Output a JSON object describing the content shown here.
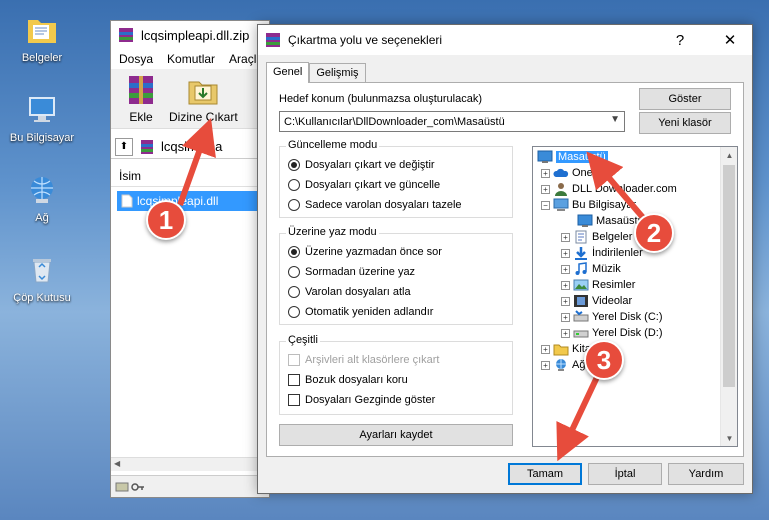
{
  "desktop": {
    "icons": [
      {
        "label": "Belgeler",
        "icon": "folder-documents-icon"
      },
      {
        "label": "Bu Bilgisayar",
        "icon": "computer-icon"
      },
      {
        "label": "Ağ",
        "icon": "network-icon"
      },
      {
        "label": "Çöp Kutusu",
        "icon": "recycle-bin-icon"
      }
    ]
  },
  "archive_window": {
    "title": "lcqsimpleapi.dll.zip",
    "menu": [
      "Dosya",
      "Komutlar",
      "Araçla"
    ],
    "toolbar": {
      "add_label": "Ekle",
      "extract_label": "Dizine Çıkart"
    },
    "path": "lcqsimplea",
    "list_header": "İsim",
    "file": "lcqsimpleapi.dll"
  },
  "dialog": {
    "title": "Çıkartma yolu ve seçenekleri",
    "help_btn": "?",
    "close_btn": "✕",
    "tabs": {
      "general": "Genel",
      "advanced": "Gelişmiş"
    },
    "target_label": "Hedef konum (bulunmazsa oluşturulacak)",
    "target_value": "C:\\Kullanıcılar\\DllDownloader_com\\Masaüstü",
    "show_button": "Göster",
    "new_folder_button": "Yeni klasör",
    "update_mode": {
      "title": "Güncelleme modu",
      "options": [
        "Dosyaları çıkart ve değiştir",
        "Dosyaları çıkart ve güncelle",
        "Sadece varolan dosyaları tazele"
      ],
      "selected": 0
    },
    "overwrite_mode": {
      "title": "Üzerine yaz modu",
      "options": [
        "Üzerine yazmadan önce sor",
        "Sormadan üzerine yaz",
        "Varolan dosyaları atla",
        "Otomatik yeniden adlandır"
      ],
      "selected": 0
    },
    "misc": {
      "title": "Çeşitli",
      "options": [
        {
          "label": "Arşivleri alt klasörlere çıkart",
          "checked": false,
          "disabled": true
        },
        {
          "label": "Bozuk dosyaları koru",
          "checked": false,
          "disabled": false
        },
        {
          "label": "Dosyaları Gezginde göster",
          "checked": false,
          "disabled": false
        }
      ]
    },
    "save_settings_button": "Ayarları kaydet",
    "tree": [
      {
        "label": "Masaüstü",
        "level": 0,
        "exp": "",
        "icon": "desktop-icon",
        "selected": true
      },
      {
        "label": "OneDr",
        "level": 1,
        "exp": "+",
        "icon": "onedrive-icon"
      },
      {
        "label": "DLL Downloader.com",
        "level": 1,
        "exp": "+",
        "icon": "user-icon"
      },
      {
        "label": "Bu Bilgisayar",
        "level": 1,
        "exp": "−",
        "icon": "computer-icon"
      },
      {
        "label": "Masaüstü",
        "level": 2,
        "exp": "",
        "icon": "desktop-icon"
      },
      {
        "label": "Belgeler",
        "level": 2,
        "exp": "+",
        "icon": "documents-icon"
      },
      {
        "label": "İndirilenler",
        "level": 2,
        "exp": "+",
        "icon": "downloads-icon"
      },
      {
        "label": "Müzik",
        "level": 2,
        "exp": "+",
        "icon": "music-icon"
      },
      {
        "label": "Resimler",
        "level": 2,
        "exp": "+",
        "icon": "pictures-icon"
      },
      {
        "label": "Videolar",
        "level": 2,
        "exp": "+",
        "icon": "videos-icon"
      },
      {
        "label": "Yerel Disk (C:)",
        "level": 2,
        "exp": "+",
        "icon": "drive-icon"
      },
      {
        "label": "Yerel Disk (D:)",
        "level": 2,
        "exp": "+",
        "icon": "drive-icon"
      },
      {
        "label": "Kitapl",
        "level": 1,
        "exp": "+",
        "icon": "library-icon"
      },
      {
        "label": "Ağ",
        "level": 1,
        "exp": "+",
        "icon": "network-icon"
      }
    ],
    "ok_button": "Tamam",
    "cancel_button": "İptal",
    "help_button": "Yardım"
  },
  "annotations": {
    "step1": "1",
    "step2": "2",
    "step3": "3",
    "color": "#e74c3c"
  }
}
